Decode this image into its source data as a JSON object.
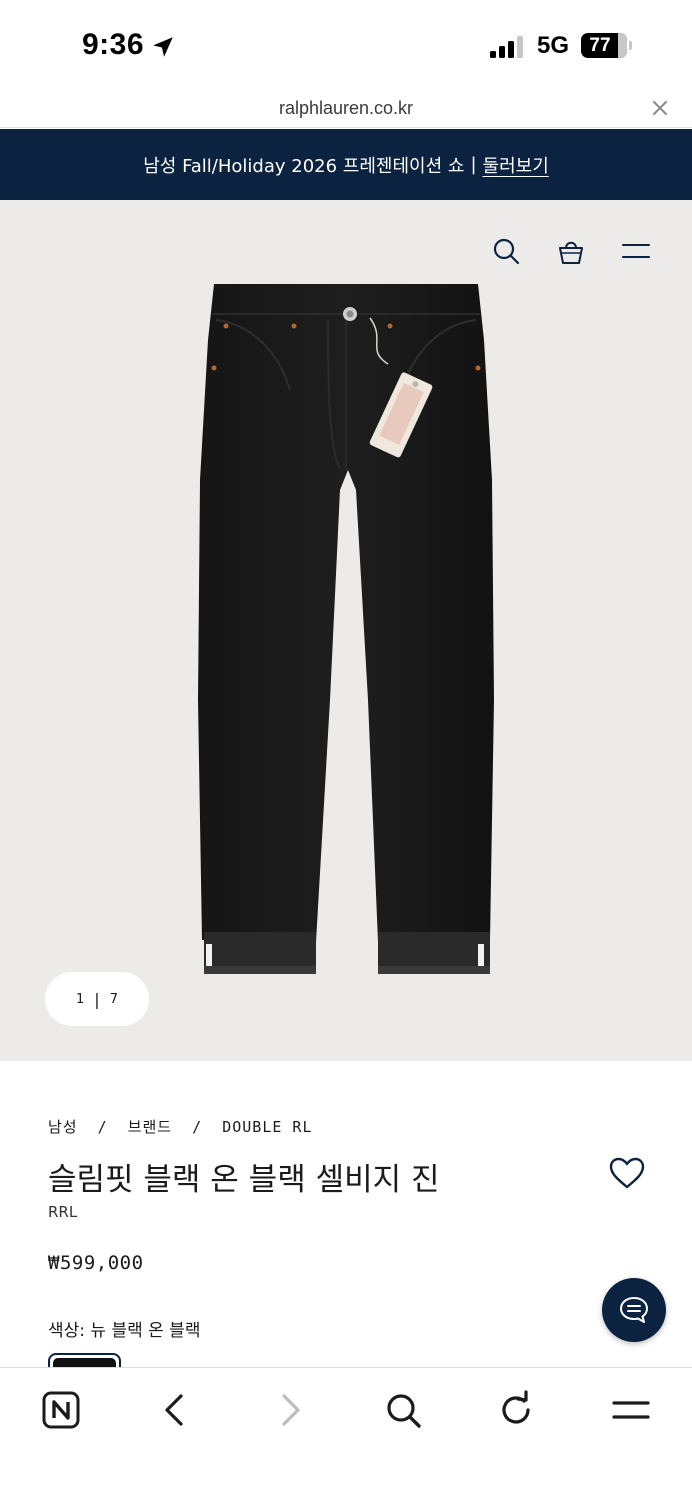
{
  "status_bar": {
    "time": "9:36",
    "network": "5G",
    "battery": "77",
    "icons": [
      "location-arrow-icon",
      "cellular-signal-icon",
      "battery-icon"
    ]
  },
  "browser": {
    "url": "ralphlauren.co.kr",
    "close_icon": "close-icon"
  },
  "promo": {
    "text": "남성 Fall/Holiday 2026 프레젠테이션 쇼",
    "separator": "|",
    "link": "둘러보기"
  },
  "header": {
    "icons": [
      "search-icon",
      "shopping-bag-icon",
      "menu-icon"
    ]
  },
  "gallery": {
    "current": "1",
    "separator": "|",
    "total": "7"
  },
  "product": {
    "breadcrumb": [
      "남성",
      "브랜드",
      "DOUBLE RL"
    ],
    "breadcrumb_sep": "/",
    "title": "슬림핏 블랙 온 블랙 셀비지 진",
    "brand": "RRL",
    "price": "₩599,000",
    "color_label": "색상: 뉴 블랙 온 블랙",
    "wishlist_icon": "heart-icon",
    "chat_icon": "chat-icon"
  },
  "toolbar": {
    "icons": [
      "naver-logo-icon",
      "back-icon",
      "forward-icon",
      "search-icon",
      "refresh-icon",
      "menu-icon"
    ]
  },
  "colors": {
    "navy": "#0b2240",
    "gallery_bg": "#ecebea"
  }
}
